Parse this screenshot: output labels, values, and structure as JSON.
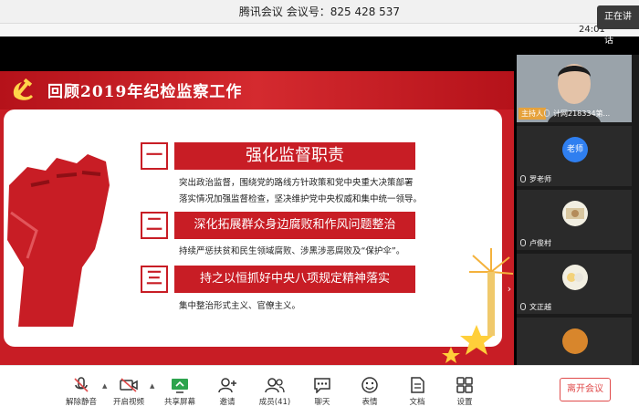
{
  "window": {
    "title": "腾讯会议 会议号：825 428 537",
    "speaking_tip": "正在讲话",
    "timer": "24:01"
  },
  "slide": {
    "header": "回顾2019年纪检监察工作",
    "items": [
      {
        "number": "一",
        "title": "强化监督职责",
        "desc_lines": [
          "突出政治监督，围绕党的路线方针政策和党中央重大决策部署",
          "落实情况加强监督检查，坚决维护党中央权威和集中统一领导。"
        ]
      },
      {
        "number": "二",
        "title": "深化拓展群众身边腐败和作风问题整治",
        "desc_lines": [
          "持续严惩扶贫和民生领域腐败、涉黑涉恶腐败及“保护伞”。"
        ]
      },
      {
        "number": "三",
        "title": "持之以恒抓好中央八项规定精神落实",
        "desc_lines": [
          "集中整治形式主义、官僚主义。"
        ]
      }
    ]
  },
  "participants": {
    "host_badge": "主持人",
    "video_user": "计网218334第...",
    "list": [
      {
        "avatar_text": "老师",
        "name": "罗老师"
      },
      {
        "avatar_text": "",
        "name": "卢俊村"
      },
      {
        "avatar_text": "",
        "name": "文正越"
      }
    ]
  },
  "controls": {
    "mute": "解除静音",
    "video": "开启视频",
    "share": "共享屏幕",
    "invite": "邀请",
    "members": "成员(41)",
    "chat": "聊天",
    "reactions": "表情",
    "docs": "文档",
    "settings": "设置",
    "leave": "离开会议"
  },
  "colors": {
    "slide_red": "#c81d25",
    "host_badge": "#e6a23c",
    "teacher_avatar": "#2f7ff0",
    "leave": "#e04a4a"
  }
}
